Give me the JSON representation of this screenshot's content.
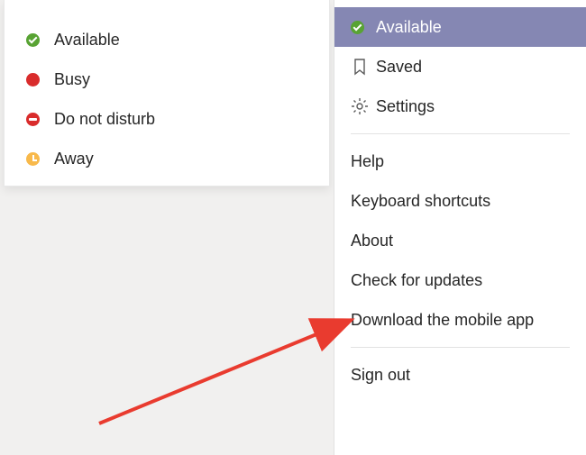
{
  "presence": {
    "items": [
      {
        "label": "Available",
        "status": "available"
      },
      {
        "label": "Busy",
        "status": "busy"
      },
      {
        "label": "Do not disturb",
        "status": "dnd"
      },
      {
        "label": "Away",
        "status": "away"
      }
    ]
  },
  "menu": {
    "available_label": "Available",
    "saved_label": "Saved",
    "settings_label": "Settings",
    "help_label": "Help",
    "keyboard_label": "Keyboard shortcuts",
    "about_label": "About",
    "check_updates_label": "Check for updates",
    "download_app_label": "Download the mobile app",
    "signout_label": "Sign out"
  },
  "colors": {
    "accent_selected": "#8587b3",
    "available": "#58a333",
    "busy": "#d92c2c",
    "away": "#f8b94b",
    "arrow": "#e93b2f"
  }
}
